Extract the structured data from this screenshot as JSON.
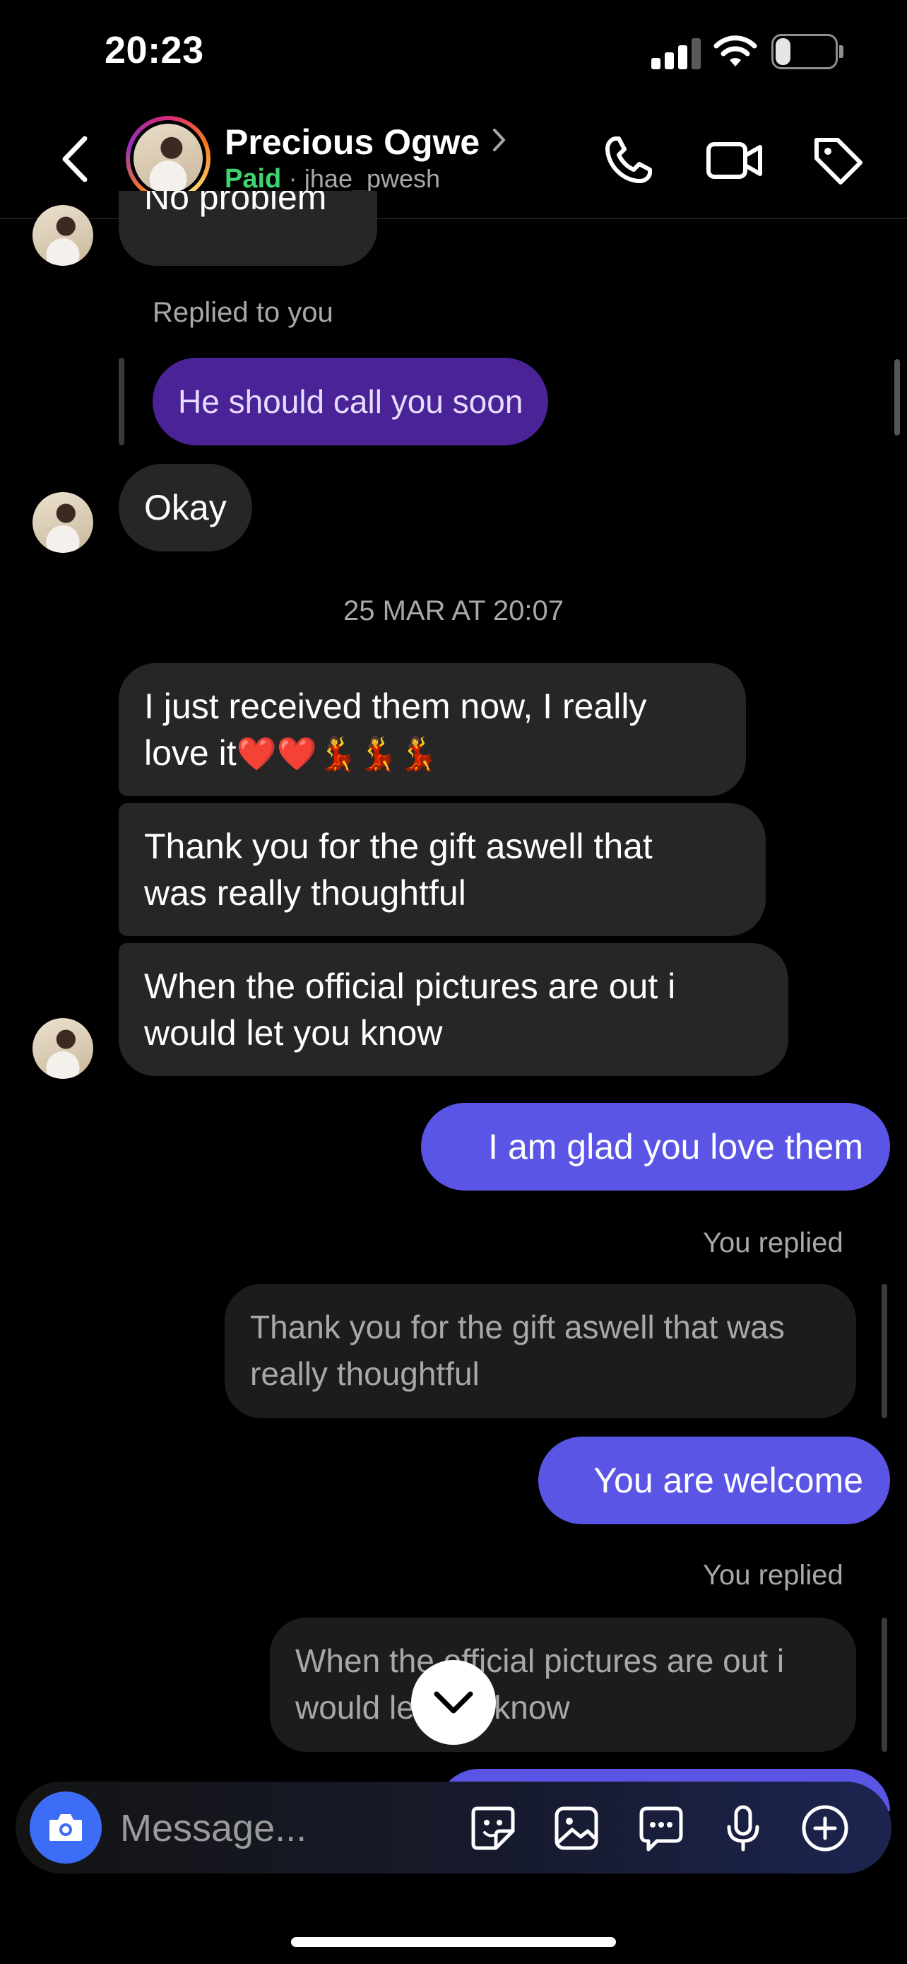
{
  "status": {
    "time": "20:23",
    "battery": "23"
  },
  "header": {
    "name": "Precious Ogwe",
    "paid_label": "Paid",
    "separator": "·",
    "username": "jhae_pwesh"
  },
  "messages": {
    "top_partial": "No problem",
    "replied_to_you_label": "Replied to you",
    "quoted_sent": "He should call you soon",
    "okay": "Okay",
    "date_separator": "25 MAR AT 20:07",
    "received_1_line1": "I just received them now, I really",
    "received_1_line2": "love it",
    "received_1_emoji": "❤️❤️💃💃💃",
    "received_2_line1": "Thank you for the gift aswell that",
    "received_2_line2": "was really thoughtful",
    "received_3_line1": "When the official pictures are out i",
    "received_3_line2": "would let you know",
    "sent_1": "I am glad you love them",
    "you_replied_label_1": "You replied",
    "reply_quote_1_line1": "Thank you for the gift aswell that was",
    "reply_quote_1_line2": "really thoughtful",
    "sent_2": "You are welcome",
    "you_replied_label_2": "You replied",
    "reply_quote_2_line1": "When the official pictures are out i",
    "reply_quote_2_line2": "would let you know"
  },
  "composer": {
    "placeholder": "Message..."
  },
  "colors": {
    "sent_bubble": "#5b55e6",
    "quoted_sent_bubble": "#4a2396",
    "received_bubble": "#262626",
    "paid_green": "#3ed470",
    "camera_button": "#3d6cf6"
  },
  "icons": [
    "back-chevron-icon",
    "phone-icon",
    "video-camera-icon",
    "tag-icon",
    "camera-icon",
    "sticker-icon",
    "gallery-icon",
    "chat-bubble-icon",
    "microphone-icon",
    "plus-circle-icon",
    "chevron-down-icon"
  ]
}
